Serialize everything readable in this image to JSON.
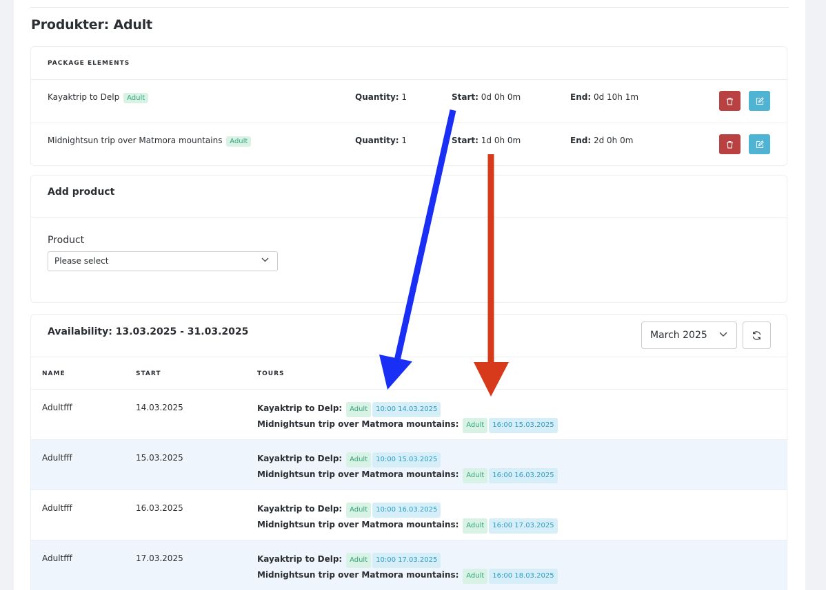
{
  "page": {
    "title": "Produkter: Adult"
  },
  "package": {
    "header": "PACKAGE ELEMENTS",
    "quantity_label": "Quantity:",
    "start_label": "Start:",
    "end_label": "End:",
    "items": [
      {
        "name": "Kayaktrip to Delp",
        "tag": "Adult",
        "quantity": "1",
        "start": "0d 0h 0m",
        "end": "0d 10h 1m"
      },
      {
        "name": "Midnightsun trip over Matmora mountains",
        "tag": "Adult",
        "quantity": "1",
        "start": "1d 0h 0m",
        "end": "2d 0h 0m"
      }
    ],
    "delete_icon": "trash-icon",
    "edit_icon": "edit-icon",
    "delete_color": "#b94141",
    "edit_color": "#4fb3d4"
  },
  "add_product": {
    "title": "Add product",
    "product_label": "Product",
    "select_value": "Please select"
  },
  "availability": {
    "title": "Availability: 13.03.2025 - 31.03.2025",
    "month_select": "March 2025",
    "columns": [
      "NAME",
      "START",
      "TOURS"
    ],
    "rows": [
      {
        "name": "Adultfff",
        "start": "14.03.2025",
        "tours": [
          {
            "label": "Kayaktrip to Delp:",
            "tag": "Adult",
            "time": "10:00 14.03.2025"
          },
          {
            "label": "Midnightsun trip over Matmora mountains:",
            "tag": "Adult",
            "time": "16:00 15.03.2025"
          }
        ]
      },
      {
        "name": "Adultfff",
        "start": "15.03.2025",
        "tours": [
          {
            "label": "Kayaktrip to Delp:",
            "tag": "Adult",
            "time": "10:00 15.03.2025"
          },
          {
            "label": "Midnightsun trip over Matmora mountains:",
            "tag": "Adult",
            "time": "16:00 16.03.2025"
          }
        ]
      },
      {
        "name": "Adultfff",
        "start": "16.03.2025",
        "tours": [
          {
            "label": "Kayaktrip to Delp:",
            "tag": "Adult",
            "time": "10:00 16.03.2025"
          },
          {
            "label": "Midnightsun trip over Matmora mountains:",
            "tag": "Adult",
            "time": "16:00 17.03.2025"
          }
        ]
      },
      {
        "name": "Adultfff",
        "start": "17.03.2025",
        "tours": [
          {
            "label": "Kayaktrip to Delp:",
            "tag": "Adult",
            "time": "10:00 17.03.2025"
          },
          {
            "label": "Midnightsun trip over Matmora mountains:",
            "tag": "Adult",
            "time": "16:00 18.03.2025"
          }
        ]
      }
    ]
  },
  "annotations": {
    "blue_arrow_color": "#1a2ff5",
    "red_arrow_color": "#d63a1a"
  }
}
